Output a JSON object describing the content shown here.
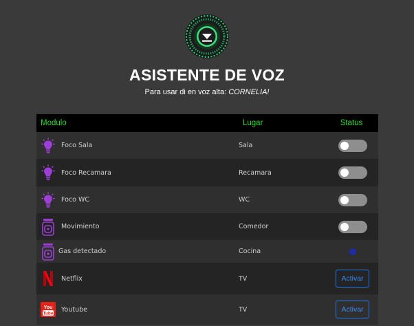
{
  "header": {
    "title": "ASISTENTE DE VOZ",
    "subtitle_prefix": "Para usar di en voz alta: ",
    "wake_word": "CORNELIA!"
  },
  "table": {
    "columns": [
      "Modulo",
      "Lugar",
      "Status"
    ],
    "rows": [
      {
        "name": "Foco Sala",
        "place": "Sala",
        "icon": "lightbulb-icon",
        "status": "toggle-off"
      },
      {
        "name": "Foco Recamara",
        "place": "Recamara",
        "icon": "lightbulb-icon",
        "status": "toggle-off"
      },
      {
        "name": "Foco WC",
        "place": "WC",
        "icon": "lightbulb-icon",
        "status": "toggle-off"
      },
      {
        "name": "Movimiento",
        "place": "Comedor",
        "icon": "sensor-icon",
        "status": "toggle-off"
      },
      {
        "name": "Gas detectado",
        "place": "Cocina",
        "icon": "sensor-icon",
        "status": "indicator"
      },
      {
        "name": "Netflix",
        "place": "TV",
        "icon": "netflix-icon",
        "status": "button",
        "button_label": "Activar"
      },
      {
        "name": "Youtube",
        "place": "TV",
        "icon": "youtube-icon",
        "status": "button",
        "button_label": "Activar"
      }
    ]
  },
  "colors": {
    "background": "#3a3a3a",
    "header_green": "#2bdc2b",
    "bulb_purple": "#9b3fd6",
    "button_blue": "#2b7bf0",
    "netflix_red": "#e50914",
    "youtube_red": "#e62117"
  }
}
